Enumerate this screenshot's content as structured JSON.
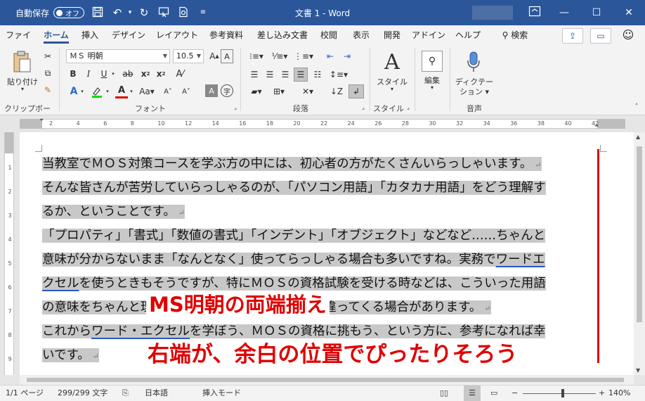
{
  "titlebar": {
    "autosave_label": "自動保存",
    "autosave_state": "オフ",
    "title": "文書 1 - Word",
    "win_min": "—",
    "win_max": "☐",
    "win_close": "✕"
  },
  "tabs": [
    "ファイル",
    "ホーム",
    "挿入",
    "デザイン",
    "レイアウト",
    "参考資料",
    "差し込み文書",
    "校閲",
    "表示",
    "開発",
    "アドイン",
    "ヘルプ"
  ],
  "search_label": "検索",
  "ribbon": {
    "groups": {
      "clipboard": "クリップボード",
      "font": "フォント",
      "paragraph": "段落",
      "style": "スタイル",
      "voice": "音声"
    },
    "paste_label": "貼り付け",
    "font_name": "ＭＳ 明朝",
    "font_size": "10.5",
    "style_label": "スタイル",
    "edit_label": "編集",
    "dictate_label1": "ディクテー",
    "dictate_label2": "ション"
  },
  "ruler": {
    "numbers": [
      "2",
      "4",
      "6",
      "8",
      "10",
      "12",
      "14",
      "16",
      "18",
      "20",
      "22",
      "24",
      "26",
      "28",
      "30",
      "32",
      "34",
      "36",
      "38",
      "40",
      "42"
    ],
    "vnumbers": [
      "1",
      "2",
      "3",
      "4",
      "5",
      "6",
      "7",
      "8",
      "9"
    ]
  },
  "document": {
    "lines": [
      {
        "text": "当教室でＭＯＳ対策コースを学ぶ方の中には、初心者の方がたくさんいらっしゃいます。",
        "mark": "↵"
      },
      {
        "text": "そんな皆さんが苦労していらっしゃるのが、「パソコン用語」「カタカナ用語」をどう理解す",
        "mark": ""
      },
      {
        "text": "るか、ということです。",
        "mark": "↵"
      },
      {
        "text": "「プロパティ」「書式」「数値の書式」「インデント」「オブジェクト」などなど……ちゃんと",
        "mark": ""
      },
      {
        "pre": "意味が分からないまま「なんとなく」使ってらっしゃる場合も多いですね。実務で",
        "wavy": "ワードエ",
        "post": "",
        "mark": ""
      },
      {
        "pre": "",
        "wavy": "クセル",
        "post": "を使うときもそうですが、特にＭＯＳの資格試験を受ける時などは、こういった用語",
        "mark": ""
      },
      {
        "text": "の意味をちゃんと理解しているかどうかで、点数が違ってくる場合があります。",
        "mark": "↵"
      },
      {
        "pre": "これから",
        "wavy": "ワード・エクセル",
        "post": "を学ぼう、ＭＯＳの資格に挑もう、という方に、参考になれば幸",
        "mark": ""
      },
      {
        "text": "いです。",
        "mark": "↵"
      }
    ],
    "annotation_1": "MS明朝の両端揃え",
    "annotation_2": "右端が、余白の位置でぴったりそろう"
  },
  "statusbar": {
    "page": "1/1 ページ",
    "words": "299/299 文字",
    "language": "日本語",
    "mode": "挿入モード",
    "zoom": "140%",
    "zoom_level_percent": 140
  },
  "colors": {
    "title_bg": "#2b579a",
    "annotation": "#e00000",
    "selection": "#c8c8c8"
  }
}
